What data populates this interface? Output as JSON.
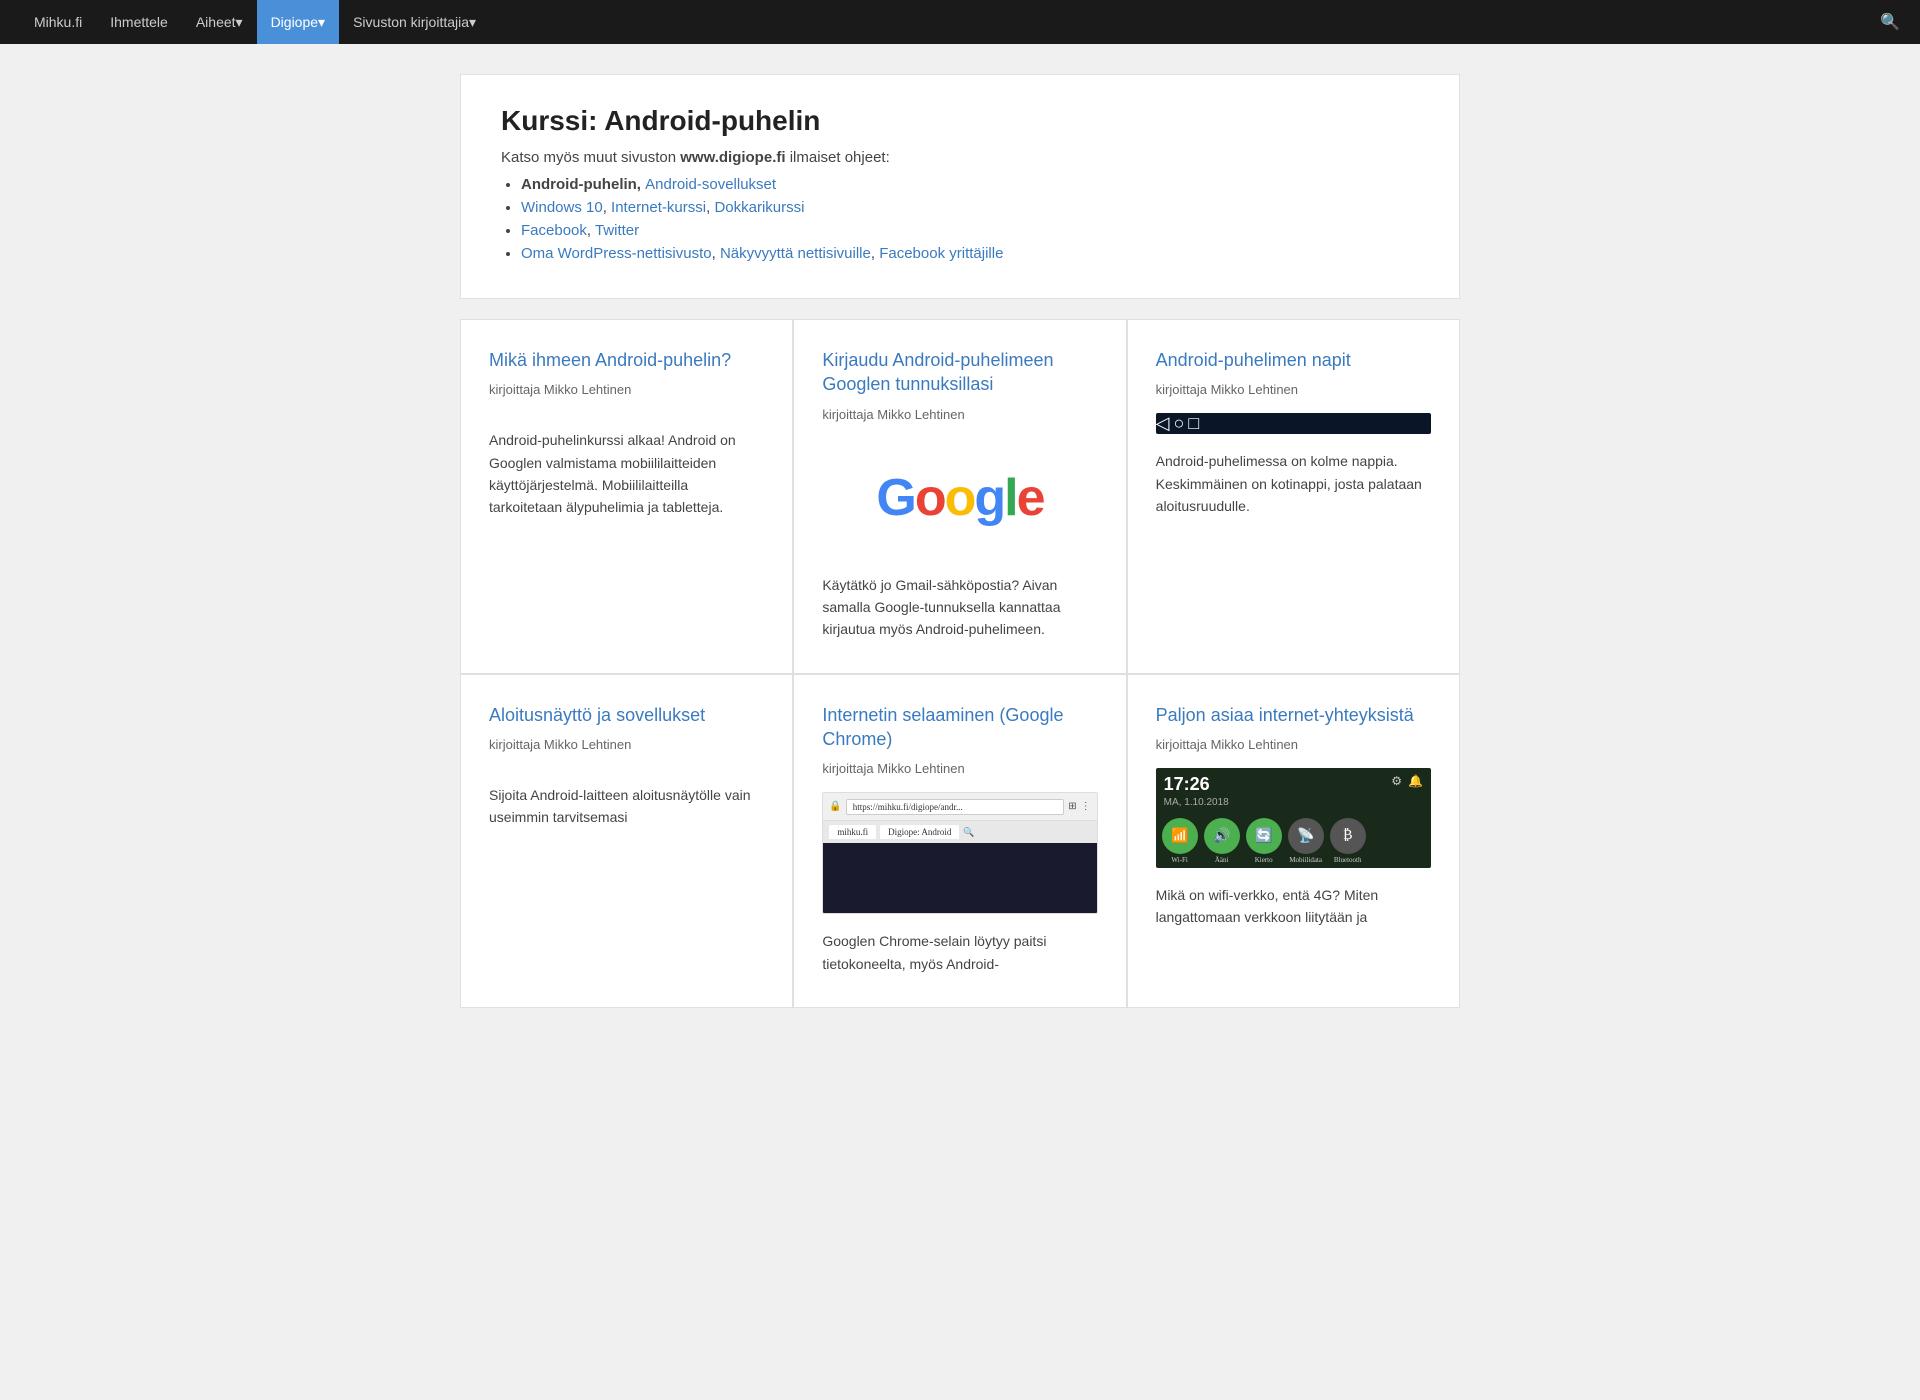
{
  "nav": {
    "items": [
      {
        "label": "Mihku.fi",
        "href": "#",
        "active": false
      },
      {
        "label": "Ihmettele",
        "href": "#",
        "active": false
      },
      {
        "label": "Aiheet",
        "href": "#",
        "active": false,
        "dropdown": true
      },
      {
        "label": "Digiope",
        "href": "#",
        "active": true,
        "dropdown": true
      },
      {
        "label": "Sivuston kirjoittajia",
        "href": "#",
        "active": false,
        "dropdown": true
      }
    ]
  },
  "header": {
    "title": "Kurssi: Android-puhelin",
    "intro": "Katso myös muut sivuston ",
    "site": "www.digiope.fi",
    "intro2": " ilmaiset ohjeet:",
    "list": [
      {
        "bold": "Android-puhelin, ",
        "links": [
          {
            "label": "Android-sovellukset",
            "href": "#"
          }
        ]
      },
      {
        "links": [
          {
            "label": "Windows 10",
            "href": "#"
          },
          {
            "label": ", Internet-kurssi, ",
            "plain": true
          },
          {
            "label": "Dokkarikurssi",
            "href": "#"
          }
        ]
      },
      {
        "links": [
          {
            "label": "Facebook",
            "href": "#"
          },
          {
            "label": ", ",
            "plain": true
          },
          {
            "label": "Twitter",
            "href": "#"
          }
        ]
      },
      {
        "links": [
          {
            "label": "Oma WordPress-nettisivusto",
            "href": "#"
          },
          {
            "label": ", ",
            "plain": true
          },
          {
            "label": "Näkyvyyttä nettisivuille",
            "href": "#"
          },
          {
            "label": ", ",
            "plain": true
          },
          {
            "label": "Facebook yrittäjille",
            "href": "#"
          }
        ]
      }
    ]
  },
  "cards": [
    {
      "id": "card-1",
      "title": "Mikä ihmeen Android-puhelin?",
      "author": "kirjoittaja Mikko Lehtinen",
      "image_type": "android-phone",
      "body": "Android-puhelinkurssi alkaa! Android on Googlen valmistama mobiililaitteiden käyttöjärjestelmä. Mobiililaitteilla tarkoitetaan älypuhelimia ja tabletteja."
    },
    {
      "id": "card-2",
      "title": "Kirjaudu Android-puhelimeen Googlen tunnuksillasi",
      "author": "kirjoittaja Mikko Lehtinen",
      "image_type": "google-logo",
      "body": "Käytätkö jo Gmail-sähköpostia? Aivan samalla Google-tunnuksella kannattaa kirjautua myös Android-puhelimeen."
    },
    {
      "id": "card-3",
      "title": "Android-puhelimen napit",
      "author": "kirjoittaja Mikko Lehtinen",
      "image_type": "android-navbar",
      "body": "Android-puhelimessa on kolme nappia. Keskimmäinen on kotinappi, josta palataan aloitusruudulle."
    },
    {
      "id": "card-4",
      "title": "Aloitusnäyttö ja sovellukset",
      "author": "kirjoittaja Mikko Lehtinen",
      "image_type": "phone-apps",
      "body": "Sijoita Android-laitteen aloitusnäytölle vain useimmin tarvitsemasi"
    },
    {
      "id": "card-5",
      "title": "Internetin selaaminen (Google Chrome)",
      "author": "kirjoittaja Mikko Lehtinen",
      "image_type": "chrome",
      "body": "Googlen Chrome-selain löytyy paitsi tietokoneelta, myös Android-"
    },
    {
      "id": "card-6",
      "title": "Paljon asiaa internet-yhteyksistä",
      "author": "kirjoittaja Mikko Lehtinen",
      "image_type": "quick-settings",
      "body": "Mikä on wifi-verkko, entä 4G? Miten langattomaan verkkoon liitytään ja"
    }
  ],
  "google_logo": {
    "G": "G",
    "o1": "o",
    "o2": "o",
    "g": "g",
    "l": "l",
    "e": "e"
  },
  "quick_settings": {
    "time": "17:26",
    "date": "MA, 1.10.2018",
    "icons": [
      "wifi",
      "volume",
      "rotate",
      "data",
      "bluetooth"
    ]
  },
  "chrome_url": "https://mihku.fi/digiope/andr...",
  "chrome_tab": "mihku.fi",
  "chrome_tab2": "Digiope: Android"
}
